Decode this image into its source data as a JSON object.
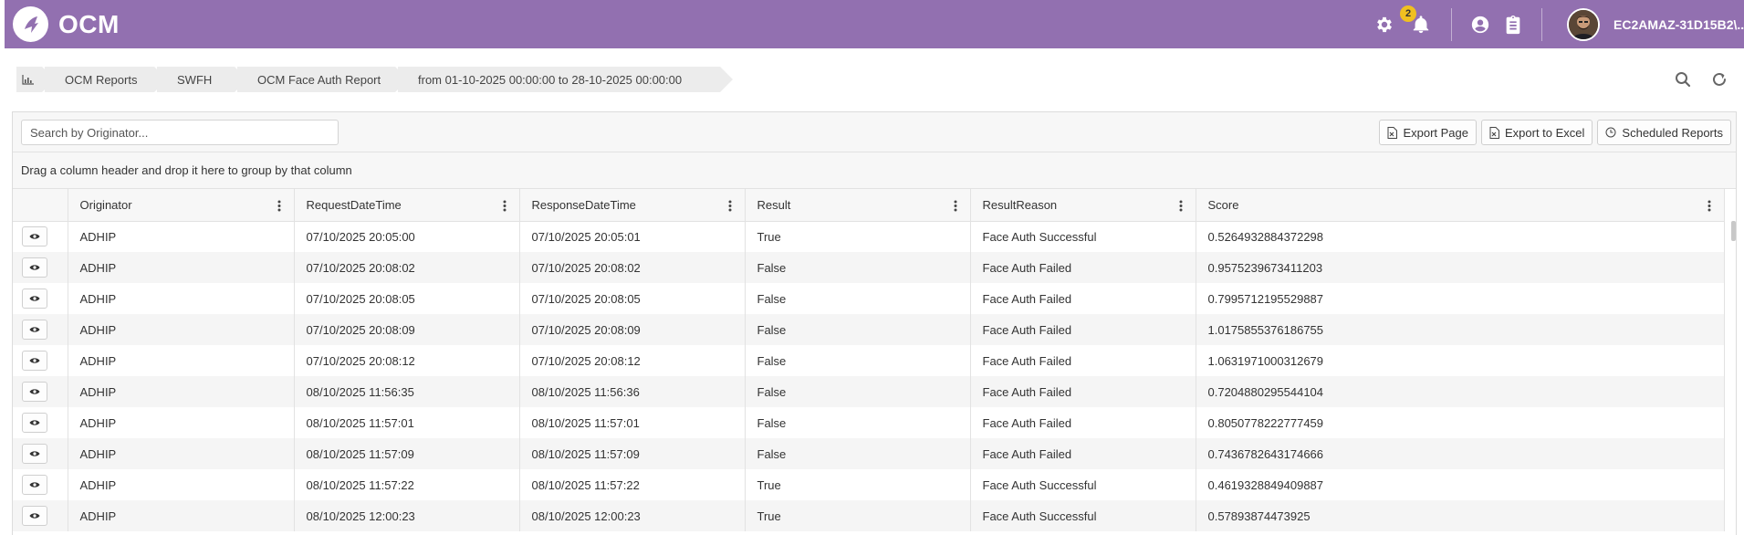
{
  "header": {
    "app_title": "OCM",
    "notification_count": "2",
    "user_name": "EC2AMAZ-31D15B2\\...",
    "icons": [
      "logo-icon",
      "gear-icon",
      "bell-icon",
      "user-circle-icon",
      "clipboard-icon",
      "avatar"
    ],
    "accent_color": "#9270b0"
  },
  "breadcrumb": {
    "items": [
      "OCM Reports",
      "SWFH",
      "OCM Face Auth Report",
      "from 01-10-2025 00:00:00 to 28-10-2025 00:00:00"
    ],
    "icons": [
      "chart-bar-icon",
      "search-icon",
      "refresh-icon"
    ]
  },
  "toolbar": {
    "search_placeholder": "Search by Originator...",
    "export_page": "Export Page",
    "export_excel": "Export to Excel",
    "scheduled_reports": "Scheduled Reports"
  },
  "grid": {
    "group_hint": "Drag a column header and drop it here to group by that column",
    "columns": [
      "Originator",
      "RequestDateTime",
      "ResponseDateTime",
      "Result",
      "ResultReason",
      "Score"
    ],
    "rows": [
      [
        "ADHIP",
        "07/10/2025 20:05:00",
        "07/10/2025 20:05:01",
        "True",
        "Face Auth Successful",
        "0.5264932884372298"
      ],
      [
        "ADHIP",
        "07/10/2025 20:08:02",
        "07/10/2025 20:08:02",
        "False",
        "Face Auth Failed",
        "0.9575239673411203"
      ],
      [
        "ADHIP",
        "07/10/2025 20:08:05",
        "07/10/2025 20:08:05",
        "False",
        "Face Auth Failed",
        "0.7995712195529887"
      ],
      [
        "ADHIP",
        "07/10/2025 20:08:09",
        "07/10/2025 20:08:09",
        "False",
        "Face Auth Failed",
        "1.0175855376186755"
      ],
      [
        "ADHIP",
        "07/10/2025 20:08:12",
        "07/10/2025 20:08:12",
        "False",
        "Face Auth Failed",
        "1.0631971000312679"
      ],
      [
        "ADHIP",
        "08/10/2025 11:56:35",
        "08/10/2025 11:56:36",
        "False",
        "Face Auth Failed",
        "0.7204880295544104"
      ],
      [
        "ADHIP",
        "08/10/2025 11:57:01",
        "08/10/2025 11:57:01",
        "False",
        "Face Auth Failed",
        "0.8050778222777459"
      ],
      [
        "ADHIP",
        "08/10/2025 11:57:09",
        "08/10/2025 11:57:09",
        "False",
        "Face Auth Failed",
        "0.7436782643174666"
      ],
      [
        "ADHIP",
        "08/10/2025 11:57:22",
        "08/10/2025 11:57:22",
        "True",
        "Face Auth Successful",
        "0.4619328849409887"
      ],
      [
        "ADHIP",
        "08/10/2025 12:00:23",
        "08/10/2025 12:00:23",
        "True",
        "Face Auth Successful",
        "0.57893874473925"
      ]
    ]
  }
}
